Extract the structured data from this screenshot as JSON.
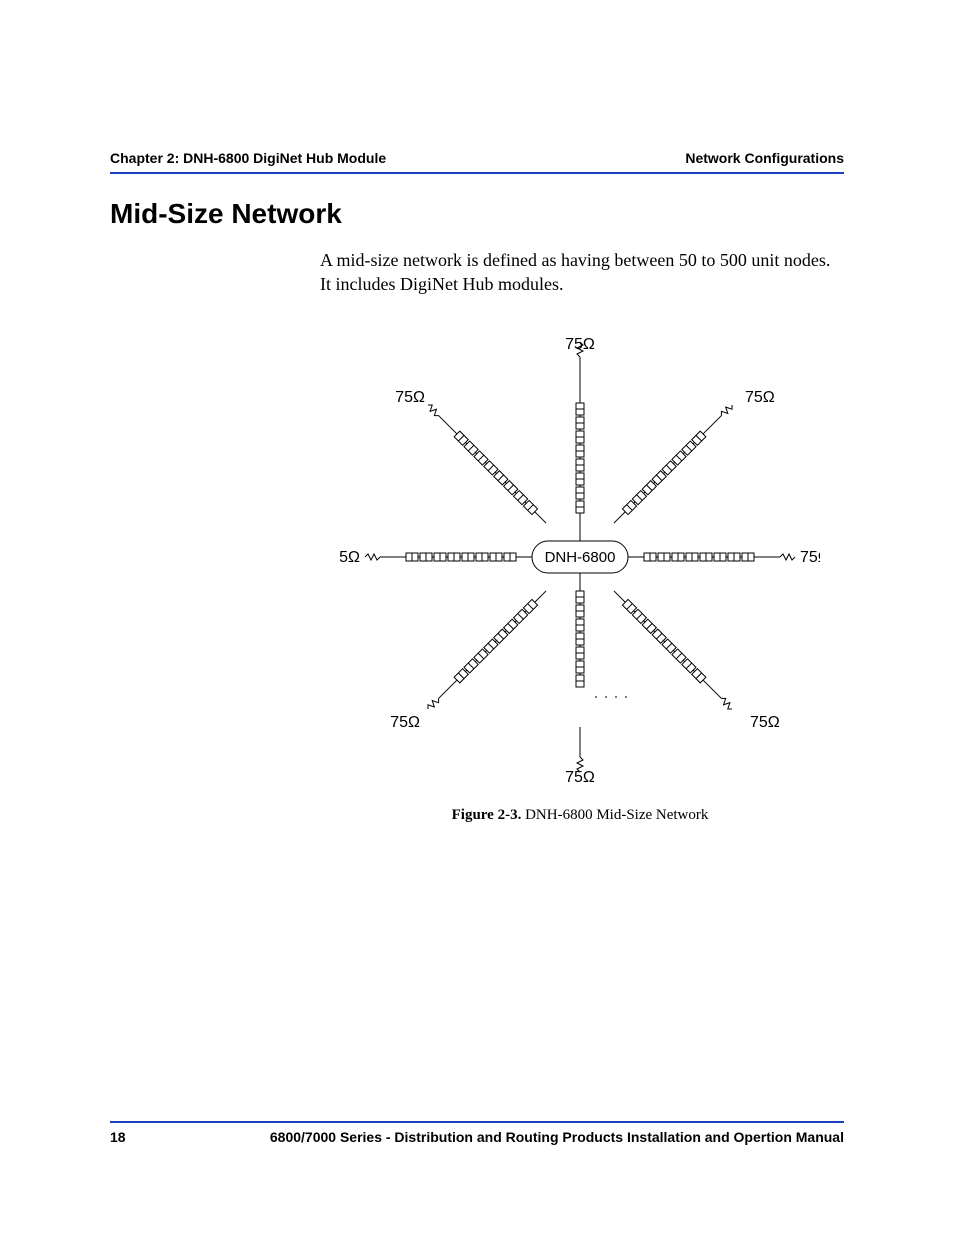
{
  "header": {
    "left": "Chapter 2: DNH-6800 DigiNet Hub Module",
    "right": "Network Configurations"
  },
  "section": {
    "title": "Mid-Size Network",
    "paragraph": "A mid-size network is defined as having between 50 to 500 unit nodes. It includes DigiNet Hub modules."
  },
  "figure": {
    "hub_label": "DNH-6800",
    "terminator_label": "75Ω",
    "caption_label": "Figure 2-3.",
    "caption_text": " DNH-6800 Mid-Size Network"
  },
  "footer": {
    "page_number": "18",
    "manual_title": "6800/7000 Series - Distribution and Routing Products Installation and Opertion Manual"
  }
}
